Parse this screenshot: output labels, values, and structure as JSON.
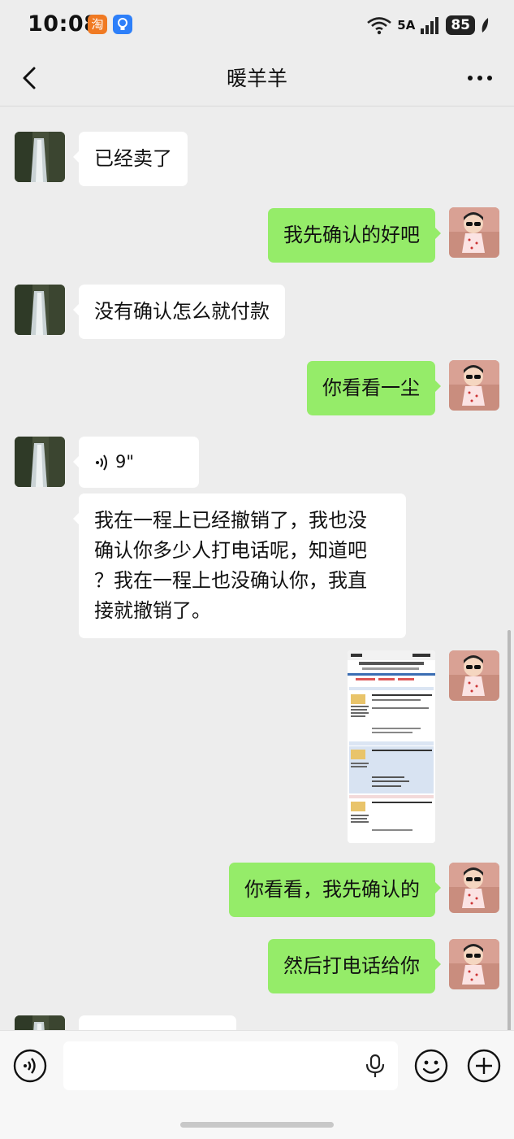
{
  "status_bar": {
    "time": "10:08",
    "taobao_badge": "淘",
    "network": "5A",
    "battery": "85"
  },
  "header": {
    "title": "暖羊羊"
  },
  "messages": [
    {
      "side": "in",
      "text": "已经卖了"
    },
    {
      "side": "out",
      "text": "我先确认的好吧"
    },
    {
      "side": "in",
      "text": "没有确认怎么就付款"
    },
    {
      "side": "out",
      "text": "你看看一尘"
    },
    {
      "side": "in",
      "type": "voice",
      "text": "9\""
    },
    {
      "side": "in",
      "lines": [
        "我在一程上已经撤销了，我也没",
        "确认你多少人打电话呢，知道吧",
        "？我在一程上也没确认你，我直",
        "接就撤销了。"
      ]
    },
    {
      "side": "out",
      "type": "image",
      "icon": "screenshot-thumbnail"
    },
    {
      "side": "out",
      "text": "你看看，我先确认的"
    },
    {
      "side": "out",
      "text": "然后打电话给你"
    }
  ],
  "colors": {
    "background": "#ededed",
    "incoming_bubble": "#ffffff",
    "outgoing_bubble": "#95ec69"
  },
  "input_bar": {
    "voice_icon": "voice-icon",
    "mic_icon": "mic-icon",
    "emoji_icon": "emoji-icon",
    "plus_icon": "plus-icon"
  }
}
